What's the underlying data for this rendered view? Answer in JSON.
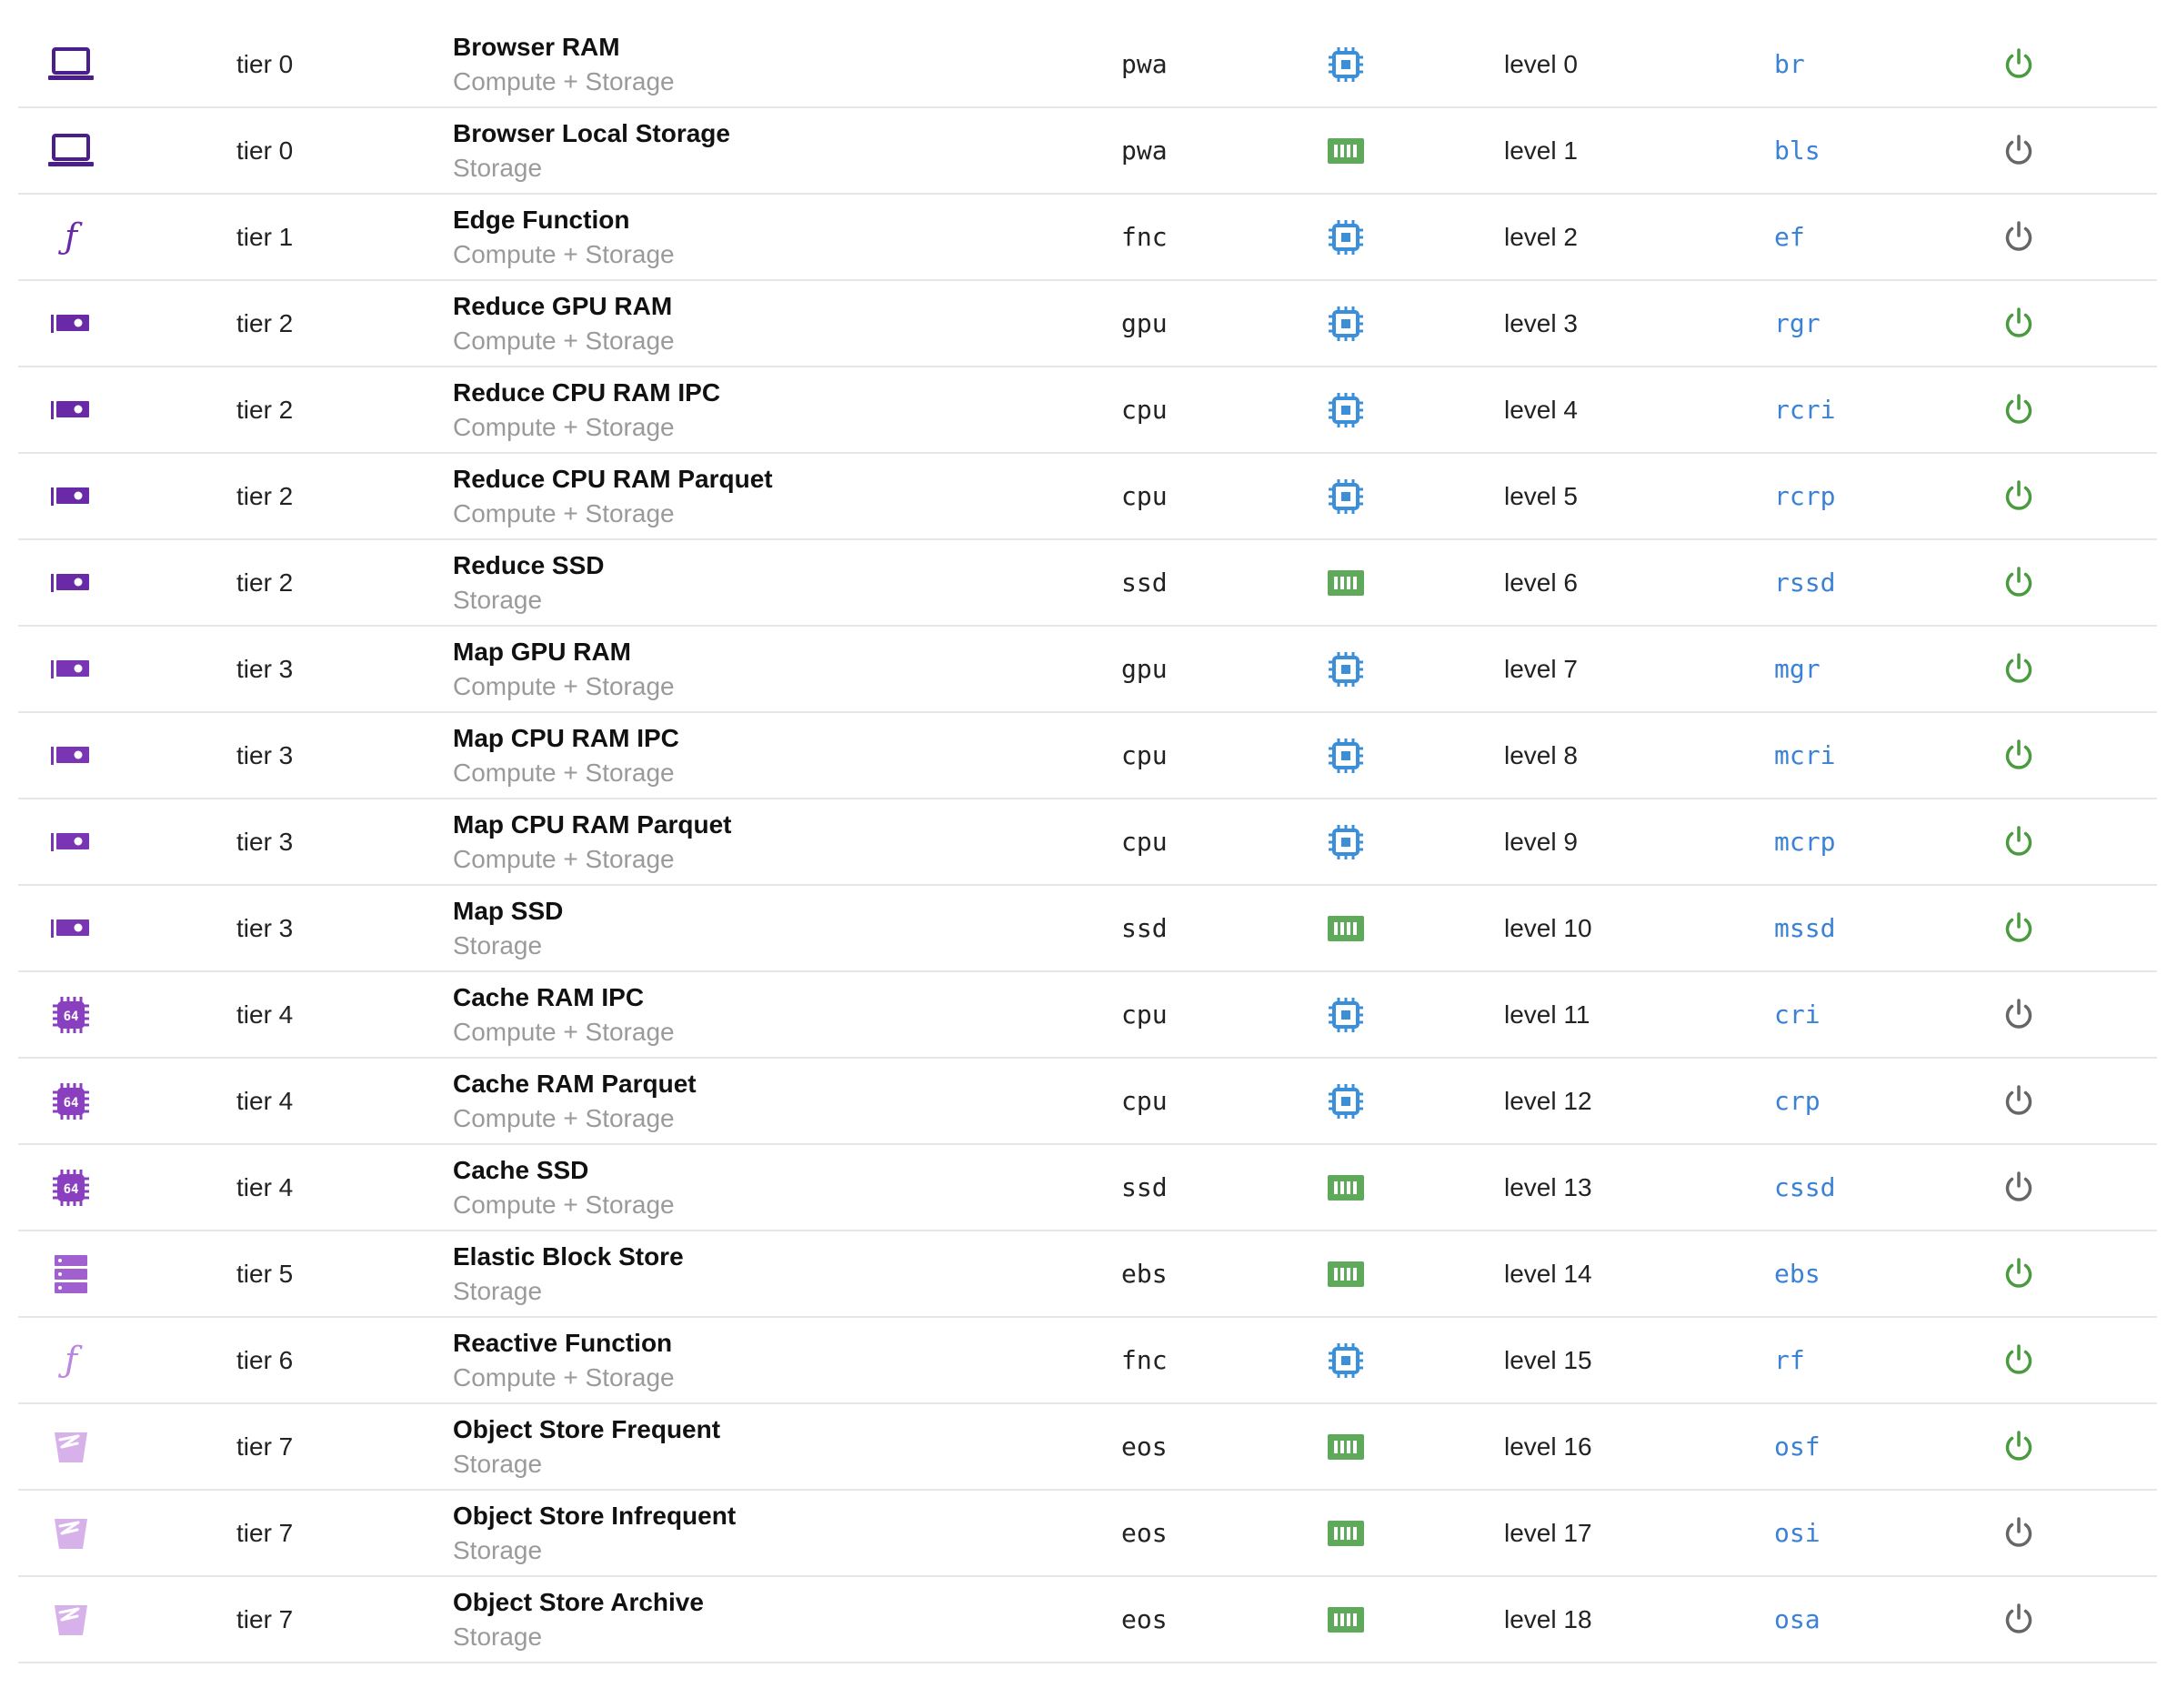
{
  "colors": {
    "link": "#3b82d6",
    "power_on": "#4a9a3f",
    "power_off": "#666666",
    "compute_icon": "#3b8ed8",
    "storage_icon": "#5fa95a"
  },
  "rows": [
    {
      "type_icon": "laptop-icon",
      "type_color": "#4a1f8c",
      "tier": "tier 0",
      "name": "Browser RAM",
      "kind": "Compute + Storage",
      "code": "pwa",
      "resource_icon": "cpu-chip-icon",
      "level": "level 0",
      "abbr": "br",
      "power": "on"
    },
    {
      "type_icon": "laptop-icon",
      "type_color": "#4a1f8c",
      "tier": "tier 0",
      "name": "Browser Local Storage",
      "kind": "Storage",
      "code": "pwa",
      "resource_icon": "memory-icon",
      "level": "level 1",
      "abbr": "bls",
      "power": "off"
    },
    {
      "type_icon": "function-icon",
      "type_color": "#6a2aa8",
      "tier": "tier 1",
      "name": "Edge Function",
      "kind": "Compute + Storage",
      "code": "fnc",
      "resource_icon": "cpu-chip-icon",
      "level": "level 2",
      "abbr": "ef",
      "power": "off"
    },
    {
      "type_icon": "gpu-card-icon",
      "type_color": "#6a2aa8",
      "tier": "tier 2",
      "name": "Reduce GPU RAM",
      "kind": "Compute + Storage",
      "code": "gpu",
      "resource_icon": "cpu-chip-icon",
      "level": "level 3",
      "abbr": "rgr",
      "power": "on"
    },
    {
      "type_icon": "gpu-card-icon",
      "type_color": "#6a2aa8",
      "tier": "tier 2",
      "name": "Reduce CPU RAM IPC",
      "kind": "Compute + Storage",
      "code": "cpu",
      "resource_icon": "cpu-chip-icon",
      "level": "level 4",
      "abbr": "rcri",
      "power": "on"
    },
    {
      "type_icon": "gpu-card-icon",
      "type_color": "#6a2aa8",
      "tier": "tier 2",
      "name": "Reduce CPU RAM Parquet",
      "kind": "Compute + Storage",
      "code": "cpu",
      "resource_icon": "cpu-chip-icon",
      "level": "level 5",
      "abbr": "rcrp",
      "power": "on"
    },
    {
      "type_icon": "gpu-card-icon",
      "type_color": "#6a2aa8",
      "tier": "tier 2",
      "name": "Reduce SSD",
      "kind": "Storage",
      "code": "ssd",
      "resource_icon": "memory-icon",
      "level": "level 6",
      "abbr": "rssd",
      "power": "on"
    },
    {
      "type_icon": "gpu-card-icon",
      "type_color": "#7a35b5",
      "tier": "tier 3",
      "name": "Map GPU RAM",
      "kind": "Compute + Storage",
      "code": "gpu",
      "resource_icon": "cpu-chip-icon",
      "level": "level 7",
      "abbr": "mgr",
      "power": "on"
    },
    {
      "type_icon": "gpu-card-icon",
      "type_color": "#7a35b5",
      "tier": "tier 3",
      "name": "Map CPU RAM IPC",
      "kind": "Compute + Storage",
      "code": "cpu",
      "resource_icon": "cpu-chip-icon",
      "level": "level 8",
      "abbr": "mcri",
      "power": "on"
    },
    {
      "type_icon": "gpu-card-icon",
      "type_color": "#7a35b5",
      "tier": "tier 3",
      "name": "Map CPU RAM Parquet",
      "kind": "Compute + Storage",
      "code": "cpu",
      "resource_icon": "cpu-chip-icon",
      "level": "level 9",
      "abbr": "mcrp",
      "power": "on"
    },
    {
      "type_icon": "gpu-card-icon",
      "type_color": "#7a35b5",
      "tier": "tier 3",
      "name": "Map SSD",
      "kind": "Storage",
      "code": "ssd",
      "resource_icon": "memory-icon",
      "level": "level 10",
      "abbr": "mssd",
      "power": "on"
    },
    {
      "type_icon": "chip-64-icon",
      "type_color": "#8a3fc0",
      "tier": "tier 4",
      "name": "Cache RAM IPC",
      "kind": "Compute + Storage",
      "code": "cpu",
      "resource_icon": "cpu-chip-icon",
      "level": "level 11",
      "abbr": "cri",
      "power": "off"
    },
    {
      "type_icon": "chip-64-icon",
      "type_color": "#8a3fc0",
      "tier": "tier 4",
      "name": "Cache RAM Parquet",
      "kind": "Compute + Storage",
      "code": "cpu",
      "resource_icon": "cpu-chip-icon",
      "level": "level 12",
      "abbr": "crp",
      "power": "off"
    },
    {
      "type_icon": "chip-64-icon",
      "type_color": "#8a3fc0",
      "tier": "tier 4",
      "name": "Cache SSD",
      "kind": "Compute + Storage",
      "code": "ssd",
      "resource_icon": "memory-icon",
      "level": "level 13",
      "abbr": "cssd",
      "power": "off"
    },
    {
      "type_icon": "server-stack-icon",
      "type_color": "#a060d0",
      "tier": "tier 5",
      "name": "Elastic Block Store",
      "kind": "Storage",
      "code": "ebs",
      "resource_icon": "memory-icon",
      "level": "level 14",
      "abbr": "ebs",
      "power": "on"
    },
    {
      "type_icon": "function-icon",
      "type_color": "#bb86df",
      "tier": "tier 6",
      "name": "Reactive Function",
      "kind": "Compute + Storage",
      "code": "fnc",
      "resource_icon": "cpu-chip-icon",
      "level": "level 15",
      "abbr": "rf",
      "power": "on"
    },
    {
      "type_icon": "bucket-icon",
      "type_color": "#d7b2ea",
      "tier": "tier 7",
      "name": "Object Store Frequent",
      "kind": "Storage",
      "code": "eos",
      "resource_icon": "memory-icon",
      "level": "level 16",
      "abbr": "osf",
      "power": "on"
    },
    {
      "type_icon": "bucket-icon",
      "type_color": "#d7b2ea",
      "tier": "tier 7",
      "name": "Object Store Infrequent",
      "kind": "Storage",
      "code": "eos",
      "resource_icon": "memory-icon",
      "level": "level 17",
      "abbr": "osi",
      "power": "off"
    },
    {
      "type_icon": "bucket-icon",
      "type_color": "#d7b2ea",
      "tier": "tier 7",
      "name": "Object Store Archive",
      "kind": "Storage",
      "code": "eos",
      "resource_icon": "memory-icon",
      "level": "level 18",
      "abbr": "osa",
      "power": "off"
    }
  ]
}
